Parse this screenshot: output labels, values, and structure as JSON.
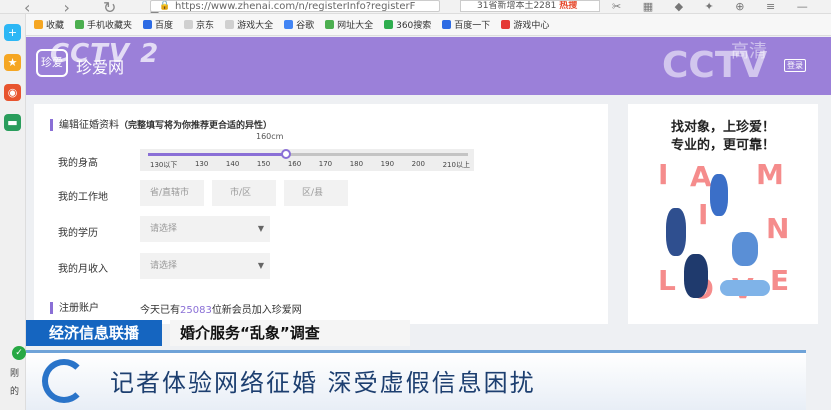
{
  "browser": {
    "nav": "‹ › ↻ ⌂",
    "url": "https://www.zhenai.com/n/registerInfo?registerF",
    "search_text": "31省新增本土2281",
    "search_hot": "热搜",
    "toolbar_icons": "✂ ▦ ◆ ✦ ⊕ ≡ —"
  },
  "bookmarks": [
    {
      "label": "收藏",
      "color": "#f5a623"
    },
    {
      "label": "手机收藏夹",
      "color": "#4caf50"
    },
    {
      "label": "百度",
      "color": "#2d6be4"
    },
    {
      "label": "京东",
      "color": "#d0d0d0"
    },
    {
      "label": "游戏大全",
      "color": "#d0d0d0"
    },
    {
      "label": "谷歌",
      "color": "#4285f4"
    },
    {
      "label": "网址大全",
      "color": "#4caf50"
    },
    {
      "label": "360搜索",
      "color": "#2fae4f"
    },
    {
      "label": "百度一下",
      "color": "#2d6be4"
    },
    {
      "label": "游戏中心",
      "color": "#e53935"
    }
  ],
  "header": {
    "logo_box": "珍爱",
    "logo_text": "珍爱网",
    "overlay_left": "CCTV 2",
    "overlay_right": "CCTV",
    "overlay_hd": "高清",
    "right_button": "登录"
  },
  "form": {
    "title": "编辑征婚资料",
    "hint": "（完整填写将为你推荐更合适的异性）",
    "height_label": "我的身高",
    "height_value": "160cm",
    "height_fraction": 0.43,
    "height_ticks": [
      "130以下",
      "130",
      "140",
      "150",
      "160",
      "170",
      "180",
      "190",
      "200",
      "210以上"
    ],
    "work_label": "我的工作地",
    "work_fields": [
      "省/直辖市",
      "市/区",
      "区/县"
    ],
    "edu_label": "我的学历",
    "edu_placeholder": "请选择",
    "income_label": "我的月收入",
    "income_placeholder": "请选择",
    "register_label": "注册账户",
    "register_prefix": "今天已有",
    "register_count": "25083",
    "register_suffix": "位新会员加入珍爱网"
  },
  "ad": {
    "line1": "找对象，上珍爱！",
    "line2": "专业的，更可靠！",
    "letters": [
      "I",
      "A",
      "M",
      "I",
      "N",
      "L",
      "O",
      "V",
      "E"
    ]
  },
  "news": {
    "program": "经济信息联播",
    "topic": "婚介服务“乱象”调查",
    "headline": "记者体验网络征婚 深受虚假信息困扰",
    "side1": "刚",
    "side2": "的"
  }
}
